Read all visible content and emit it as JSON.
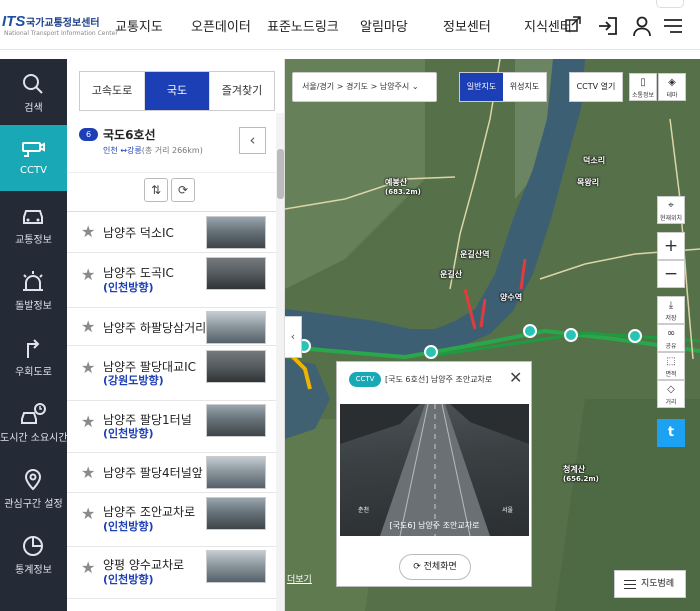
{
  "header": {
    "logo_mark": "ITS",
    "logo_title": "국가교통정보센터",
    "logo_subtitle": "National Transport Information Center",
    "nav": [
      "교통지도",
      "오픈데이터",
      "표준노드링크",
      "알림마당",
      "정보센터",
      "지식센터"
    ],
    "icons": [
      "external-link-icon",
      "login-icon",
      "user-icon",
      "menu-icon"
    ]
  },
  "left_nav": [
    {
      "label": "검색",
      "icon": "search-icon"
    },
    {
      "label": "CCTV",
      "icon": "cctv-icon",
      "active": true
    },
    {
      "label": "교통정보",
      "icon": "car-icon"
    },
    {
      "label": "돌발정보",
      "icon": "alert-light-icon"
    },
    {
      "label": "우회도로",
      "icon": "detour-icon"
    },
    {
      "label": "도시간 소요시간",
      "icon": "travel-time-icon"
    },
    {
      "label": "관심구간 설정",
      "icon": "location-pin-icon"
    },
    {
      "label": "통계정보",
      "icon": "statistics-icon"
    }
  ],
  "panel": {
    "tabs": [
      {
        "label": "고속도로"
      },
      {
        "label": "국도",
        "active": true
      },
      {
        "label": "즐겨찾기"
      }
    ],
    "route": {
      "badge": "6",
      "title": "국도6호선",
      "from": "인천",
      "arrow": "↔",
      "to": "강릉",
      "length_text": "(총 거리 266km)"
    },
    "cameras": [
      {
        "name": "남양주 덕소IC",
        "direction": ""
      },
      {
        "name": "남양주 도곡IC",
        "direction": "(인천방향)"
      },
      {
        "name": "남양주 하팔당삼거리",
        "direction": ""
      },
      {
        "name": "남양주 팔당대교IC",
        "direction": "(강원도방향)"
      },
      {
        "name": "남양주 팔당1터널",
        "direction": "(인천방향)"
      },
      {
        "name": "남양주 팔당4터널앞",
        "direction": ""
      },
      {
        "name": "남양주 조안교차로",
        "direction": "(인천방향)"
      },
      {
        "name": "양평 양수교차로",
        "direction": "(인천방향)"
      }
    ]
  },
  "map": {
    "breadcrumb": [
      "서울/경기",
      "경기도",
      "남양주시"
    ],
    "breadcrumb_sep": ">",
    "map_types": [
      {
        "label": "일반지도",
        "active": true
      },
      {
        "label": "위성지도"
      }
    ],
    "cctv_toggle": "CCTV 열기",
    "side_buttons": [
      {
        "label": "소통정보",
        "icon": "traffic-info-icon"
      },
      {
        "label": "테마",
        "icon": "layers-icon"
      }
    ],
    "tools": [
      {
        "label": "현재위치",
        "icon": "crosshair-icon"
      },
      {
        "label": "저장",
        "icon": "download-icon"
      },
      {
        "label": "공유",
        "icon": "share-icon"
      },
      {
        "label": "면적",
        "icon": "area-icon"
      },
      {
        "label": "거리",
        "icon": "ruler-icon"
      }
    ],
    "zoom_in": "+",
    "zoom_out": "−",
    "twitter": "t",
    "legend": "지도범례",
    "more": "더보기",
    "labels": [
      {
        "name": "예봉산",
        "sub": "(683.2m)"
      },
      {
        "name": "운길산역"
      },
      {
        "name": "양수역"
      },
      {
        "name": "청계산",
        "sub": "(656.2m)"
      },
      {
        "name": "목왕리"
      },
      {
        "name": "운길산"
      },
      {
        "name": "덕소리"
      }
    ]
  },
  "popup": {
    "tag": "CCTV",
    "title": "[국도 6호선] 남양주 조안교차로",
    "video_caption": "[국도6] 남양주 조안교차로",
    "video_left": "춘천",
    "video_right": "서울",
    "full_screen": "전체화면"
  }
}
